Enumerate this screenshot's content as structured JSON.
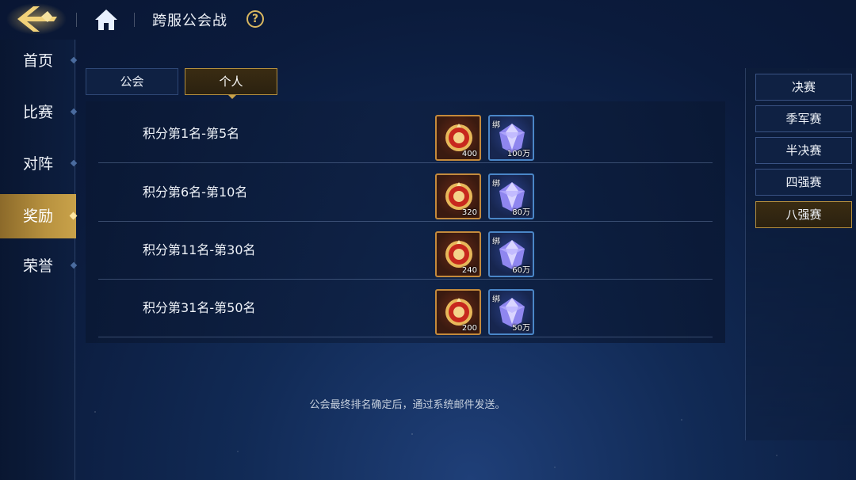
{
  "header": {
    "title": "跨服公会战",
    "help_label": "?"
  },
  "sidebar": {
    "items": [
      {
        "label": "首页",
        "active": false
      },
      {
        "label": "比赛",
        "active": false
      },
      {
        "label": "对阵",
        "active": false
      },
      {
        "label": "奖励",
        "active": true
      },
      {
        "label": "荣誉",
        "active": false
      }
    ]
  },
  "tabs": [
    {
      "label": "公会",
      "active": false
    },
    {
      "label": "个人",
      "active": true
    }
  ],
  "rewards": [
    {
      "rank": "积分第1名-第5名",
      "medal_qty": "400",
      "gem_tag": "绑",
      "gem_qty": "100万"
    },
    {
      "rank": "积分第6名-第10名",
      "medal_qty": "320",
      "gem_tag": "绑",
      "gem_qty": "80万"
    },
    {
      "rank": "积分第11名-第30名",
      "medal_qty": "240",
      "gem_tag": "绑",
      "gem_qty": "60万"
    },
    {
      "rank": "积分第31名-第50名",
      "medal_qty": "200",
      "gem_tag": "绑",
      "gem_qty": "50万"
    }
  ],
  "footnote": "公会最终排名确定后，通过系统邮件发送。",
  "stages": [
    {
      "label": "决赛",
      "active": false
    },
    {
      "label": "季军赛",
      "active": false
    },
    {
      "label": "半决赛",
      "active": false
    },
    {
      "label": "四强赛",
      "active": false
    },
    {
      "label": "八强赛",
      "active": true
    }
  ],
  "icons": {
    "back": "back-arrow-icon",
    "home": "home-icon",
    "help": "help-icon",
    "medal": "medal-icon",
    "gem": "diamond-icon"
  },
  "colors": {
    "accent_gold": "#c9a24a",
    "panel_bg": "#0f2143",
    "gem_border": "#4a86c7",
    "medal_border": "#c48a3c"
  }
}
